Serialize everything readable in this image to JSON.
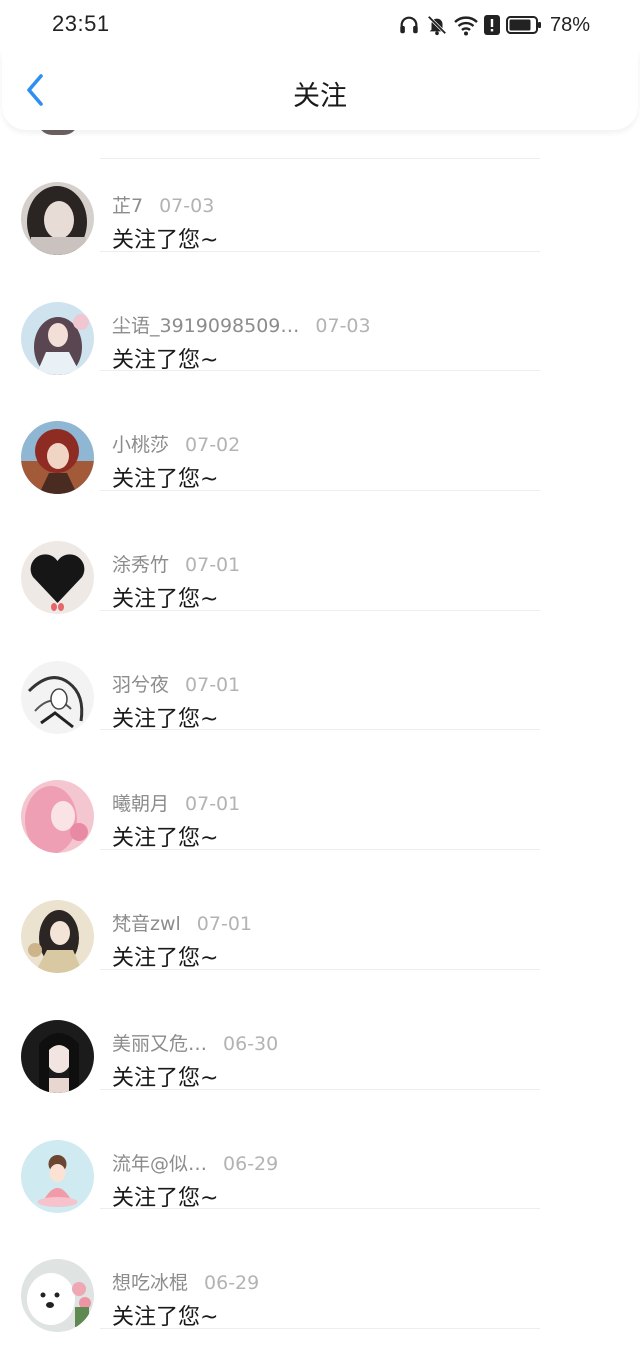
{
  "status_bar": {
    "time": "23:51",
    "battery_percent": "78%",
    "icons": [
      "headphones-icon",
      "bell-off-icon",
      "wifi-icon",
      "alert-icon",
      "battery-icon"
    ]
  },
  "nav": {
    "title": "关注",
    "back_icon": "chevron-left-icon"
  },
  "colors": {
    "accent": "#2f8ff0",
    "background": "#ffffff",
    "divider": "#eeeeee"
  },
  "items": [
    {
      "name": "芷7",
      "date": "07-03",
      "message": "关注了您~"
    },
    {
      "name": "尘语_3919098509…",
      "date": "07-03",
      "message": "关注了您~"
    },
    {
      "name": "小桃莎",
      "date": "07-02",
      "message": "关注了您~"
    },
    {
      "name": "涂秀竹",
      "date": "07-01",
      "message": "关注了您~"
    },
    {
      "name": "羽兮夜",
      "date": "07-01",
      "message": "关注了您~"
    },
    {
      "name": "曦朝月",
      "date": "07-01",
      "message": "关注了您~"
    },
    {
      "name": "梵音zwl",
      "date": "07-01",
      "message": "关注了您~"
    },
    {
      "name": "美丽又危…",
      "date": "06-30",
      "message": "关注了您~"
    },
    {
      "name": "流年@似…",
      "date": "06-29",
      "message": "关注了您~"
    },
    {
      "name": "想吃冰棍",
      "date": "06-29",
      "message": "关注了您~"
    }
  ]
}
